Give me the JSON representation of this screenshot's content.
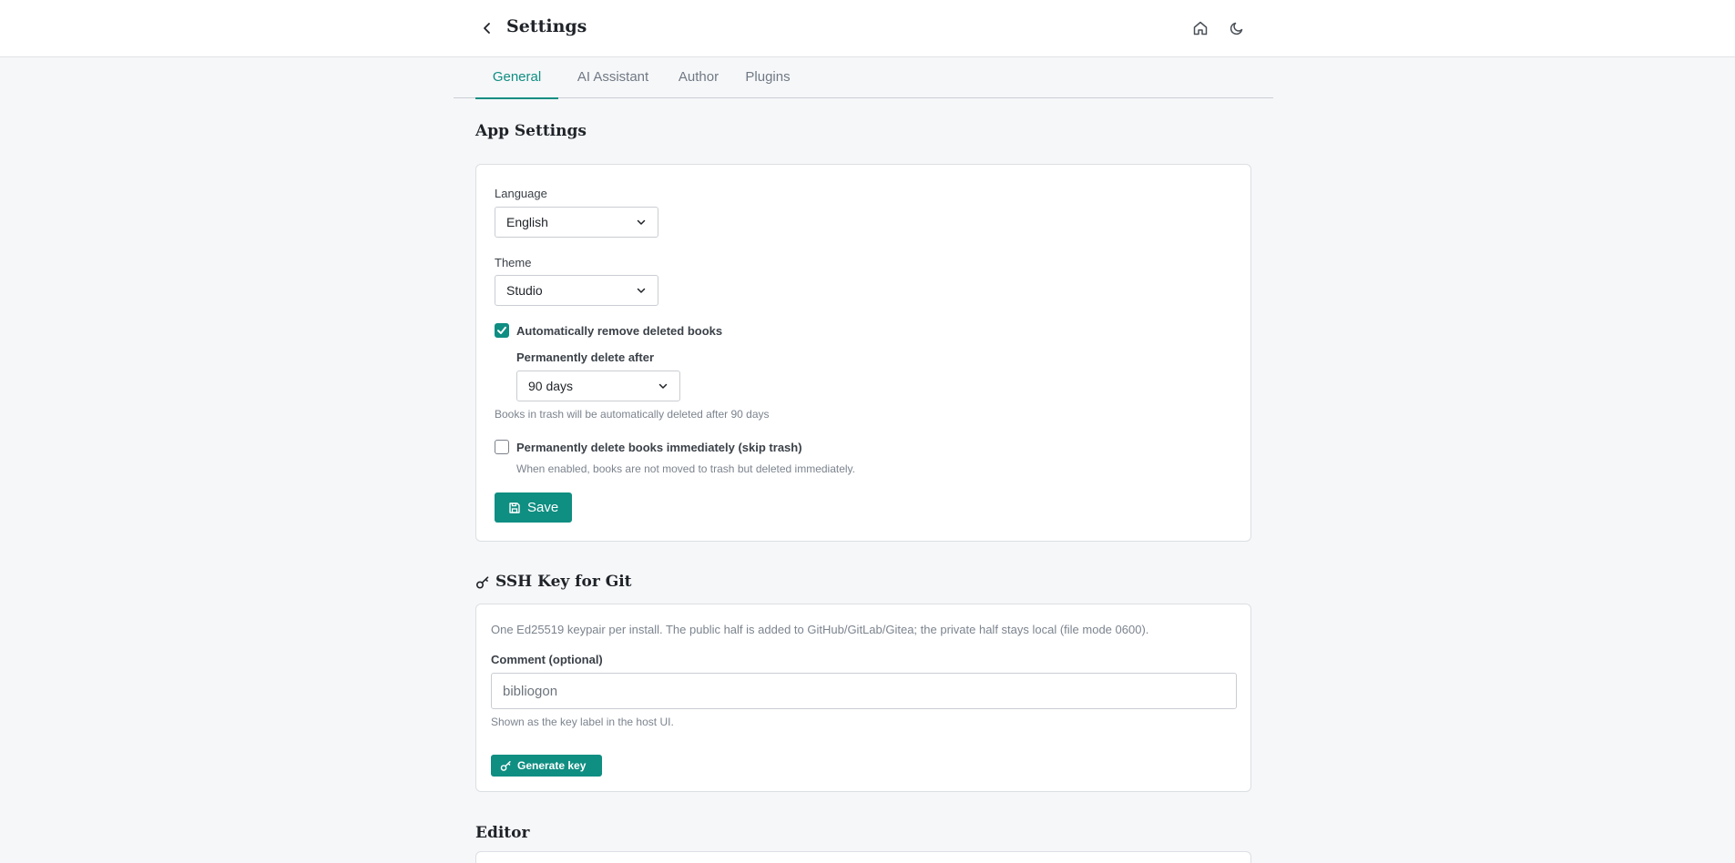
{
  "header": {
    "title": "Settings",
    "back_icon": "chevron-left-icon",
    "home_icon": "home-icon",
    "theme_icon": "moon-icon"
  },
  "tabs": [
    {
      "label": "General",
      "active": true
    },
    {
      "label": "AI Assistant",
      "active": false
    },
    {
      "label": "Author",
      "active": false
    },
    {
      "label": "Plugins",
      "active": false
    }
  ],
  "app_settings": {
    "title": "App Settings",
    "language_label": "Language",
    "language_value": "English",
    "theme_label": "Theme",
    "theme_value": "Studio",
    "auto_remove_label": "Automatically remove deleted books",
    "auto_remove_checked": true,
    "delete_after_label": "Permanently delete after",
    "delete_after_value": "90 days",
    "trash_help": "Books in trash will be automatically deleted after 90 days",
    "skip_trash_label": "Permanently delete books immediately (skip trash)",
    "skip_trash_checked": false,
    "skip_trash_help": "When enabled, books are not moved to trash but deleted immediately.",
    "save_label": "Save"
  },
  "ssh": {
    "title": "SSH Key for Git",
    "description": "One Ed25519 keypair per install. The public half is added to GitHub/GitLab/Gitea; the private half stays local (file mode 0600).",
    "comment_label": "Comment (optional)",
    "comment_placeholder": "bibliogon",
    "comment_help": "Shown as the key label in the host UI.",
    "generate_label": "Generate key"
  },
  "editor": {
    "title": "Editor"
  },
  "colors": {
    "accent": "#0f8e82",
    "background": "#f6f7f9"
  }
}
